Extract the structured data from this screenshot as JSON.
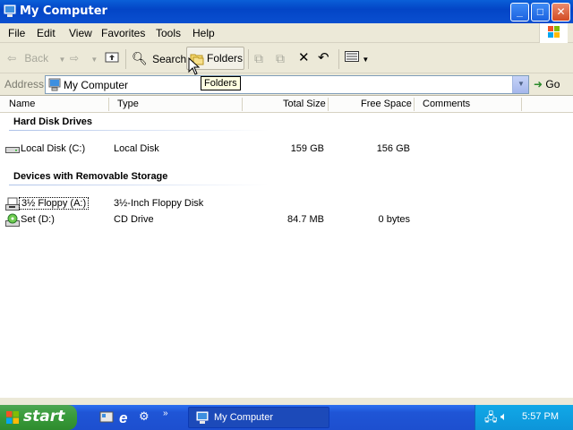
{
  "window": {
    "title": "My Computer",
    "controls": {
      "minimize": "_",
      "maximize": "□",
      "close": "✕"
    }
  },
  "menu": [
    "File",
    "Edit",
    "View",
    "Favorites",
    "Tools",
    "Help"
  ],
  "toolbar": {
    "back": "Back",
    "search": "Search",
    "folders": "Folders",
    "tooltip": "Folders"
  },
  "address": {
    "label": "Address",
    "value": "My Computer",
    "go": "Go"
  },
  "columns": [
    "Name",
    "Type",
    "Total Size",
    "Free Space",
    "Comments"
  ],
  "groups": [
    {
      "title": "Hard Disk Drives",
      "items": [
        {
          "name": "Local Disk (C:)",
          "type": "Local Disk",
          "total": "159 GB",
          "free": "156 GB",
          "comments": "",
          "icon": "hard-disk-icon"
        }
      ]
    },
    {
      "title": "Devices with Removable Storage",
      "items": [
        {
          "name": "3½ Floppy (A:)",
          "type": "3½-Inch Floppy Disk",
          "total": "",
          "free": "",
          "comments": "",
          "icon": "floppy-disk-icon"
        },
        {
          "name": "Set (D:)",
          "type": "CD Drive",
          "total": "84.7 MB",
          "free": "0 bytes",
          "comments": "",
          "icon": "cd-drive-icon"
        }
      ]
    }
  ],
  "taskbar": {
    "start": "start",
    "task": "My Computer",
    "clock": "5:57 PM"
  }
}
